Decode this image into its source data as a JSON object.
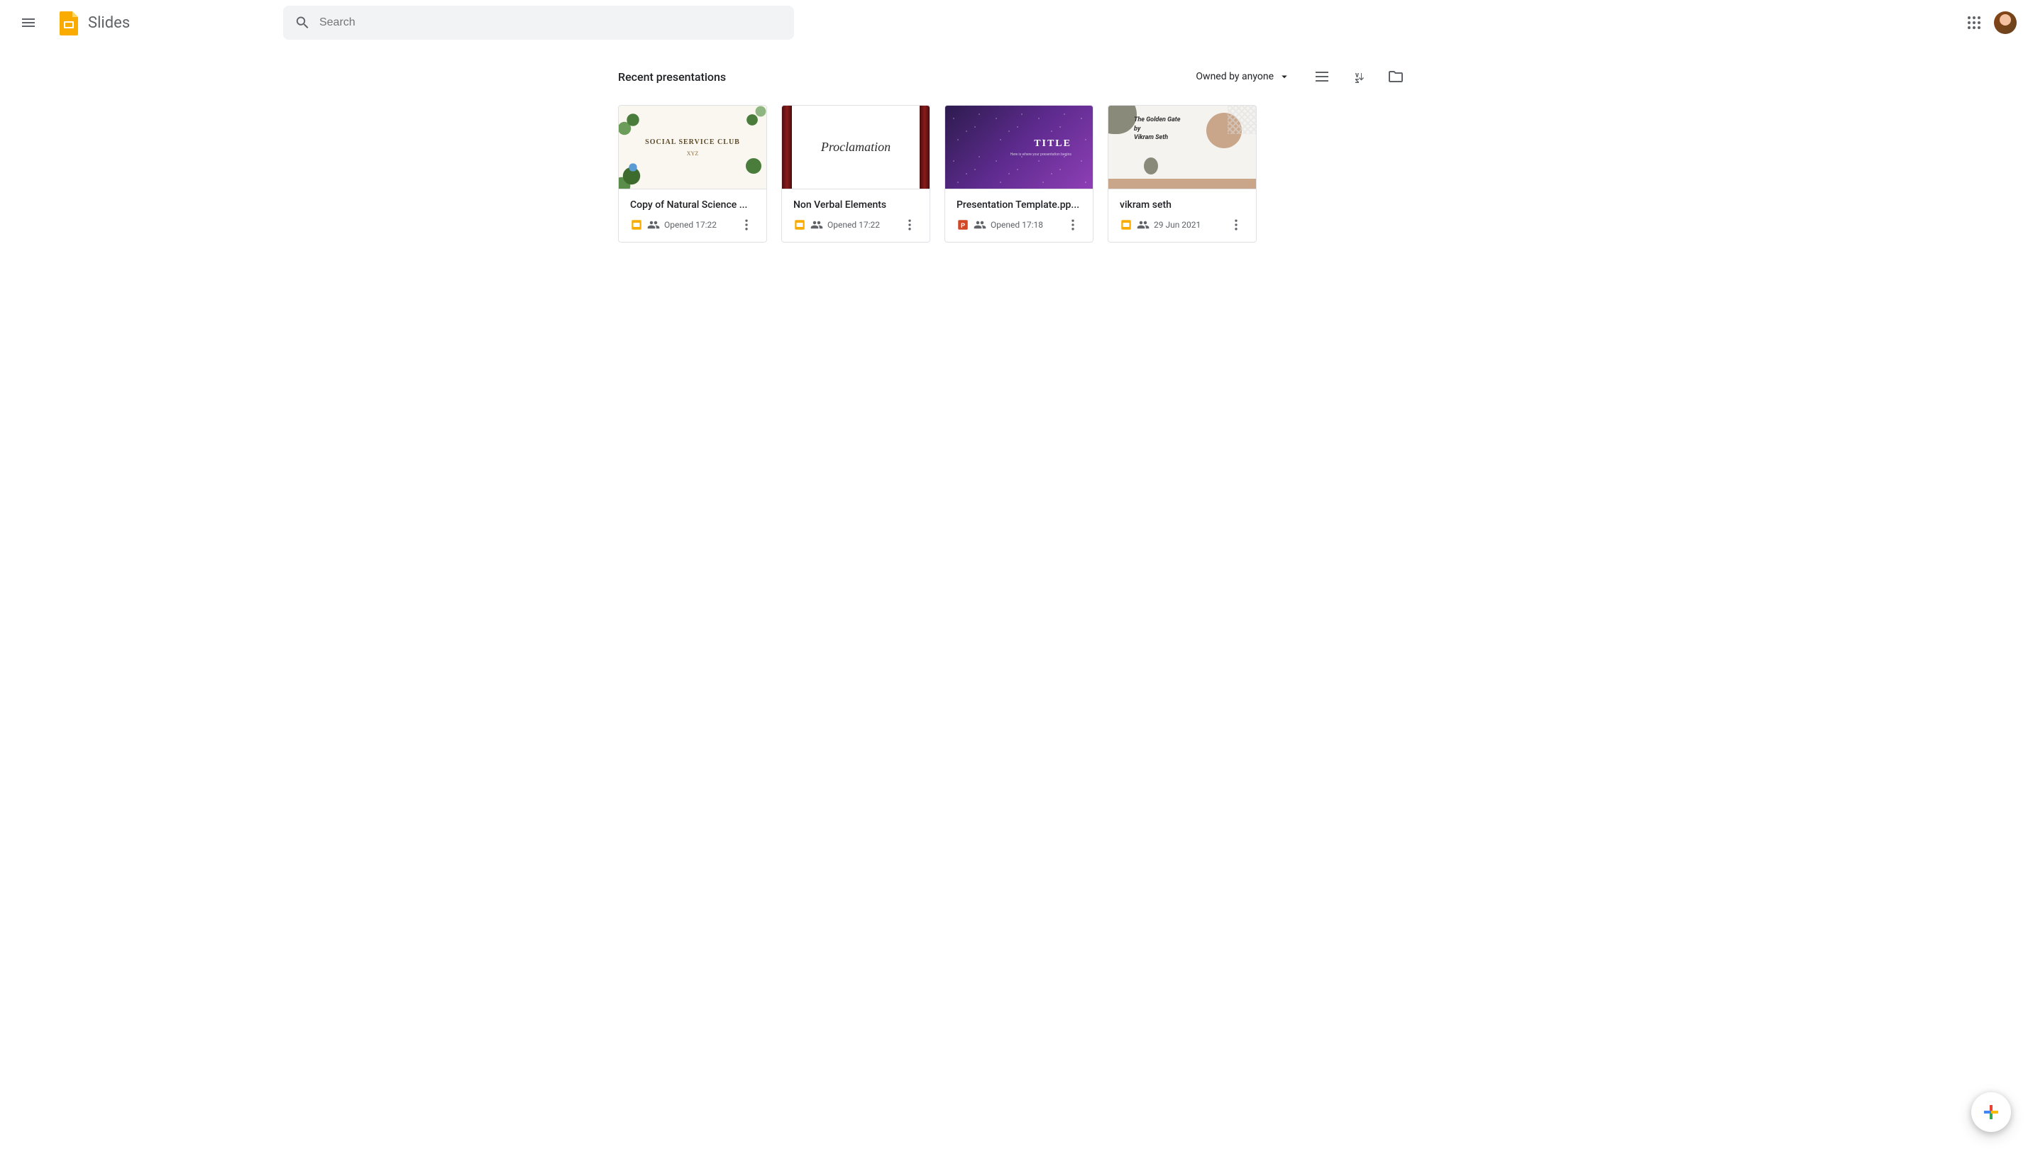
{
  "header": {
    "app_name": "Slides",
    "search_placeholder": "Search"
  },
  "toolbar": {
    "section_title": "Recent presentations",
    "filter_label": "Owned by anyone"
  },
  "presentations": [
    {
      "title": "Copy of Natural Science ...",
      "meta": "Opened 17:22",
      "file_type": "slides",
      "shared": true,
      "thumb": {
        "line1": "SOCIAL SERVICE CLUB",
        "line2": "XYZ"
      }
    },
    {
      "title": "Non Verbal Elements",
      "meta": "Opened 17:22",
      "file_type": "slides",
      "shared": true,
      "thumb": {
        "line1": "Proclamation"
      }
    },
    {
      "title": "Presentation Template.pp...",
      "meta": "Opened 17:18",
      "file_type": "powerpoint",
      "shared": true,
      "thumb": {
        "line1": "TITLE",
        "line2": "Here is where your presentation begins"
      }
    },
    {
      "title": "vikram seth",
      "meta": "29 Jun 2021",
      "file_type": "slides",
      "shared": true,
      "thumb": {
        "line1": "The Golden Gate",
        "line2": "by",
        "line3": "Vikram Seth"
      }
    }
  ]
}
